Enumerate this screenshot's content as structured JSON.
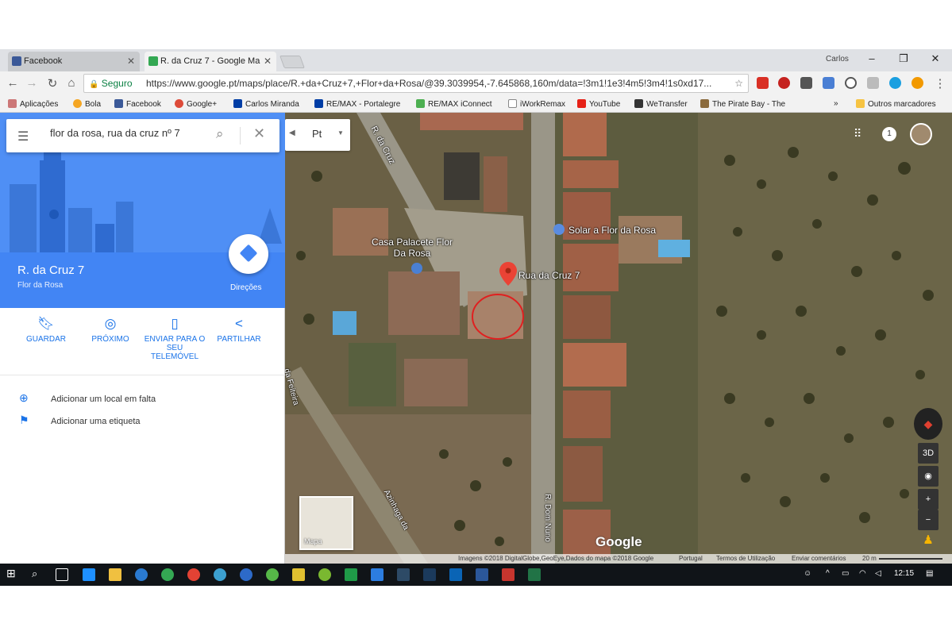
{
  "browser": {
    "tabs": [
      {
        "title": "Facebook",
        "icon": "facebook-icon",
        "active": false
      },
      {
        "title": "R. da Cruz 7 - Google Ma",
        "icon": "google-maps-icon",
        "active": true
      }
    ],
    "user": "Carlos",
    "secure_label": "Seguro",
    "url": "https://www.google.pt/maps/place/R.+da+Cruz+7,+Flor+da+Rosa/@39.3039954,-7.645868,160m/data=!3m1!1e3!4m5!3m4!1s0xd17...",
    "bookmarks": [
      "Aplicações",
      "Bola",
      "Facebook",
      "Google+",
      "Carlos Miranda",
      "RE/MAX - Portalegre",
      "RE/MAX iConnect",
      "iWorkRemax",
      "YouTube",
      "WeTransfer",
      "The Pirate Bay - The"
    ],
    "more_label": "»",
    "other_bookmarks": "Outros marcadores"
  },
  "panel": {
    "search_value": "flor da rosa, rua da cruz nº 7",
    "place_title": "R. da Cruz 7",
    "place_sub": "Flor da Rosa",
    "directions_label": "Direções",
    "actions": [
      {
        "label": "GUARDAR",
        "icon": "bookmark-icon"
      },
      {
        "label": "PRÓXIMO",
        "icon": "nearby-icon"
      },
      {
        "label": "ENVIAR PARA O SEU TELEMÓVEL",
        "icon": "send-to-phone-icon"
      },
      {
        "label": "PARTILHAR",
        "icon": "share-icon"
      }
    ],
    "links": [
      {
        "label": "Adicionar um local em falta",
        "icon": "add-place-icon"
      },
      {
        "label": "Adicionar uma etiqueta",
        "icon": "flag-icon"
      }
    ]
  },
  "map": {
    "language": "Pt",
    "labels": {
      "rua_cruz_road": "R. da Cruz",
      "casa": "Casa Palacete Flor Da Rosa",
      "solar": "Solar a Flor da Rosa",
      "pin": "Rua da Cruz 7",
      "dom_nuno": "R. Dom Nuno",
      "feiteira": "da Feiteira",
      "azinhaga": "Azinhaga da"
    },
    "thumb_label": "Mapa",
    "google_label": "Google",
    "btn_3d": "3D",
    "notification_count": "1",
    "attribution": {
      "imagery": "Imagens ©2018 DigitalGlobe,GeoEye,Dados do mapa ©2018 Google",
      "country": "Portugal",
      "terms": "Termos de Utilização",
      "feedback": "Enviar comentários",
      "scale": "20 m"
    }
  },
  "taskbar": {
    "time": "12:15"
  }
}
